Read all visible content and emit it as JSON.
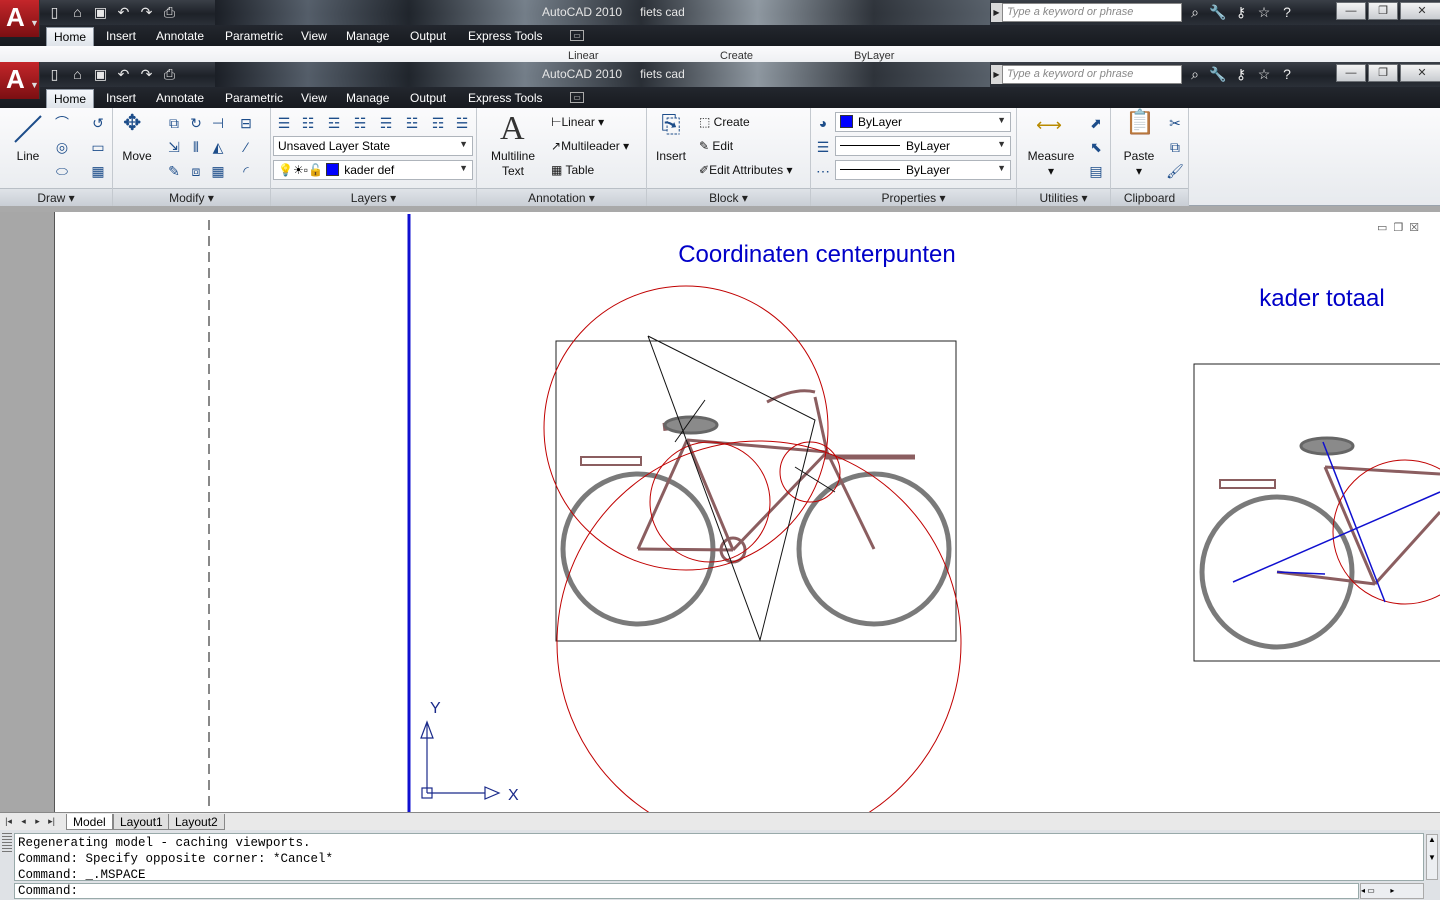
{
  "window": {
    "app_title": "AutoCAD 2010",
    "doc_title": "fiets cad",
    "search_placeholder": "Type a keyword or phrase",
    "min": "—",
    "restore": "❐",
    "close": "✕"
  },
  "tabs": [
    "Home",
    "Insert",
    "Annotate",
    "Parametric",
    "View",
    "Manage",
    "Output",
    "Express Tools"
  ],
  "ribbon": {
    "draw": {
      "title": "Draw",
      "line_label": "Line"
    },
    "modify": {
      "title": "Modify",
      "move_label": "Move"
    },
    "layers": {
      "title": "Layers",
      "layer_state": "Unsaved Layer State",
      "current_layer": "kader def"
    },
    "annotation": {
      "title": "Annotation",
      "text_label_1": "Multiline",
      "text_label_2": "Text",
      "linear": "Linear",
      "multileader": "Multileader",
      "table": "Table"
    },
    "block": {
      "title": "Block",
      "insert": "Insert",
      "create": "Create",
      "edit": "Edit",
      "edit_attributes": "Edit Attributes"
    },
    "properties": {
      "title": "Properties",
      "color": "ByLayer",
      "lineweight": "ByLayer",
      "linetype": "ByLayer",
      "color_hex": "#0000ff"
    },
    "utilities": {
      "title": "Utilities",
      "measure": "Measure"
    },
    "clipboard": {
      "title": "Clipboard",
      "paste": "Paste"
    }
  },
  "ghost_ribbon": {
    "linear": "Linear",
    "create": "Create",
    "bylayer": "ByLayer"
  },
  "canvas": {
    "title_left": "Coordinaten centerpunten",
    "title_right": "kader totaal",
    "ucs_x": "X",
    "ucs_y": "Y",
    "text_color": "#0000c8",
    "circle_color": "#c00000"
  },
  "layout_tabs": [
    "Model",
    "Layout1",
    "Layout2"
  ],
  "command": {
    "log": [
      "Regenerating model - caching viewports.",
      "Command: Specify opposite corner: *Cancel*",
      "Command: _.MSPACE"
    ],
    "prompt": "Command:"
  }
}
